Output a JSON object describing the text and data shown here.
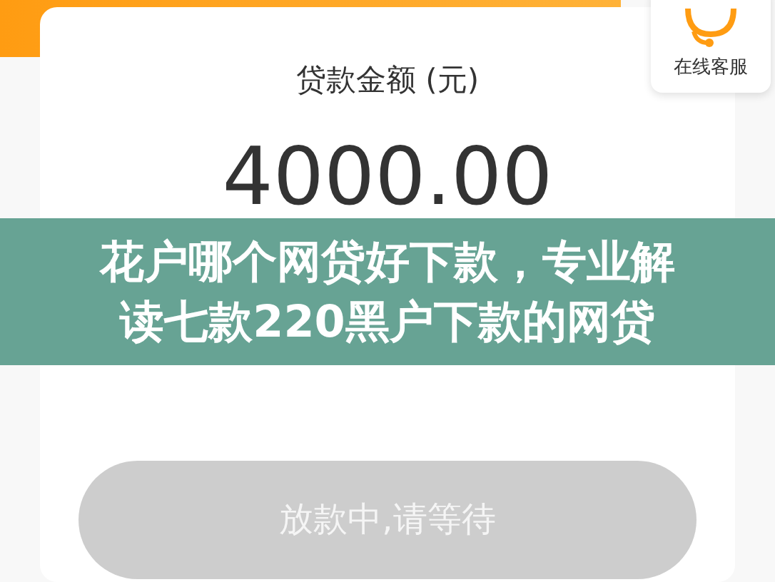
{
  "loan_card": {
    "label": "贷款金额 (元)",
    "amount": "4000.00"
  },
  "support": {
    "label": "在线客服"
  },
  "caption": {
    "lines": [
      "花户哪个网贷好下款，专业解",
      "读七款220黑户下款的网贷"
    ]
  },
  "status_button": {
    "label": "放款中,请等待",
    "disabled": true
  }
}
